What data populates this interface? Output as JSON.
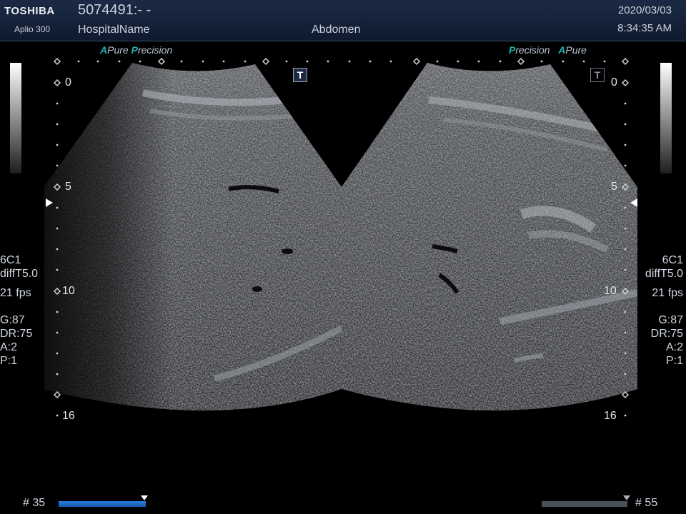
{
  "header": {
    "brand": "TOSHIBA",
    "model": "Aplio 300",
    "patient_id": "5074491:- -",
    "hospital": "HospitalName",
    "exam": "Abdomen",
    "date": "2020/03/03",
    "time": "8:34:35 AM"
  },
  "presets": {
    "left": {
      "a": "A",
      "pure": "Pure",
      "p": "P",
      "precision": "recision"
    },
    "right": {
      "p": "P",
      "precision": "recision",
      "a": "A",
      "pure": "Pure"
    }
  },
  "t_marker": "T",
  "depth_scale": {
    "left": {
      "d0": "0",
      "d5": "5",
      "d10": "10",
      "d16": "16"
    },
    "right": {
      "d0": "0",
      "d5": "5",
      "d10": "10",
      "d16": "16"
    }
  },
  "left_info": {
    "probe": "6C1",
    "mode": "diffT5.0",
    "fps": "21 fps",
    "gain": "G:87",
    "dr": "DR:75",
    "a": "A:2",
    "p": "P:1"
  },
  "right_info": {
    "probe": "6C1",
    "mode": "diffT5.0",
    "fps": "21 fps",
    "gain": "G:87",
    "dr": "DR:75",
    "a": "A:2",
    "p": "P:1"
  },
  "cine": {
    "left_frame": "# 35",
    "right_frame": "# 55"
  },
  "colors": {
    "header_bg": "#14213a",
    "accent": "#1fb3b3",
    "cine_bar": "#2a7bdc"
  }
}
